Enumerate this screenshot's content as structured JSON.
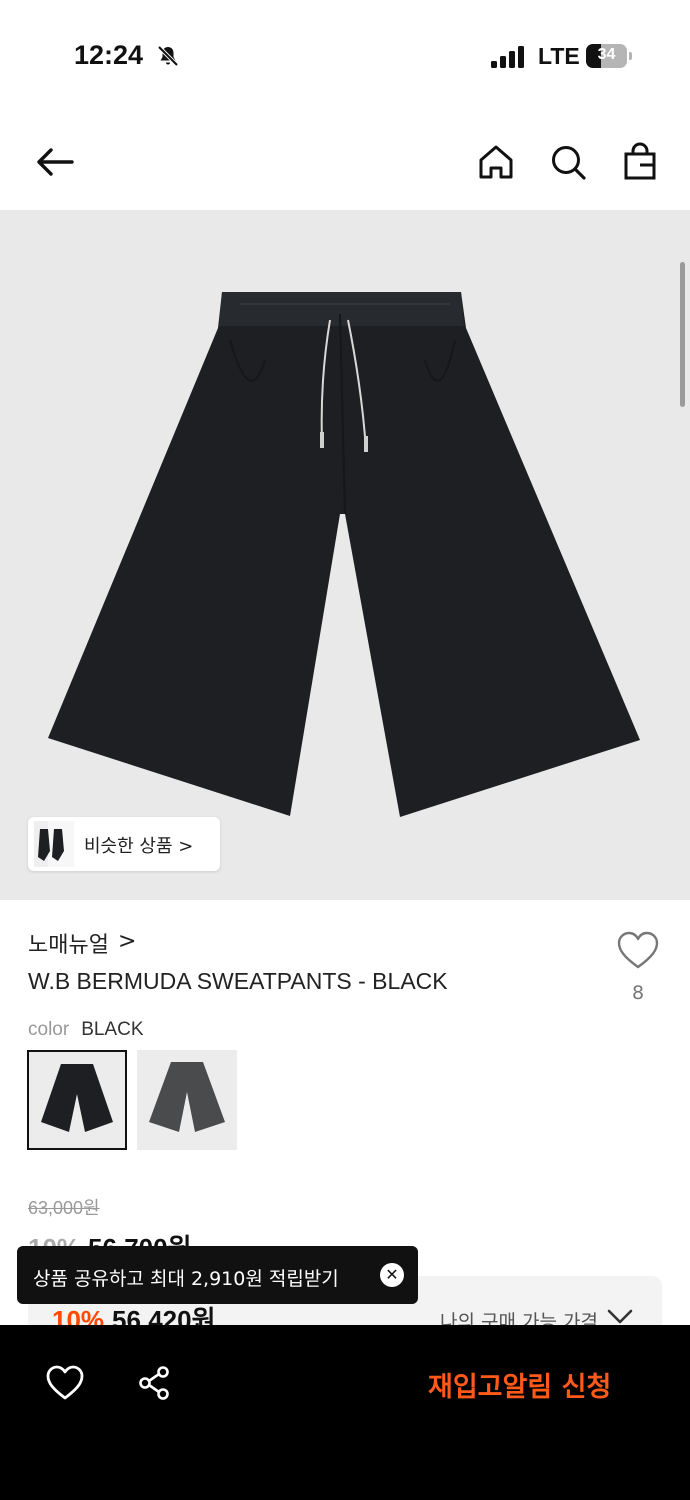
{
  "status_bar": {
    "time": "12:24",
    "network": "LTE",
    "battery": "34"
  },
  "nav": {
    "back_icon": "arrow-left-icon",
    "home_icon": "home-icon",
    "search_icon": "search-icon",
    "bag_icon": "shopping-bag-icon"
  },
  "product": {
    "similar_label": "비슷한 상품 >",
    "brand": "노매뉴얼",
    "brand_arrow": ">",
    "title": "W.B BERMUDA SWEATPANTS - BLACK",
    "like_count": "8",
    "color_key": "color",
    "color_value": "BLACK",
    "swatches": [
      "BLACK",
      "GRAY"
    ],
    "original_price": "63,000원",
    "discount_pct": "10%",
    "sale_price": "56,700원",
    "my_discount_pct": "10%",
    "my_price": "56,420원",
    "my_price_label": "나의 구매 가능 가격"
  },
  "toast": {
    "message": "상품 공유하고 최대 2,910원 적립받기"
  },
  "bottom_bar": {
    "restock_label": "재입고알림 신청"
  },
  "colors": {
    "accent": "#ff5a1a",
    "discount": "#ff4800",
    "black": "#000000",
    "image_bg": "#e9e9e9"
  }
}
